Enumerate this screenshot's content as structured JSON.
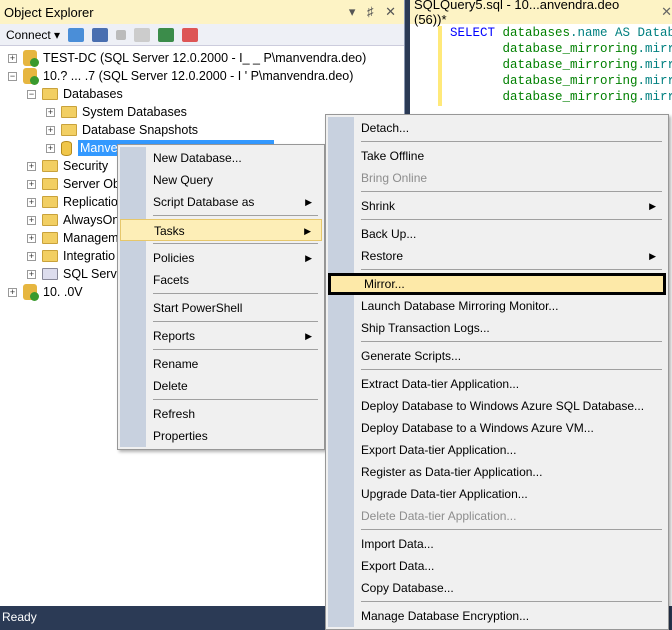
{
  "object_explorer": {
    "title": "Object Explorer",
    "controls": "▾ ♯ ✕",
    "connect_label": "Connect ▾",
    "tree": [
      {
        "label": "TEST-DC (SQL Server 12.0.2000 - I_ _ P\\manvendra.deo)",
        "level": 0,
        "exp": "+",
        "icon": "server"
      },
      {
        "label": "10.?  ...  .7 (SQL Server 12.0.2000 - I  ' P\\manvendra.deo)",
        "level": 0,
        "exp": "−",
        "icon": "server"
      },
      {
        "label": "Databases",
        "level": 1,
        "exp": "−",
        "icon": "folder"
      },
      {
        "label": "System Databases",
        "level": 2,
        "exp": "+",
        "icon": "folder"
      },
      {
        "label": "Database Snapshots",
        "level": 2,
        "exp": "+",
        "icon": "folder"
      },
      {
        "label": "Manve",
        "level": 2,
        "exp": "+",
        "icon": "db",
        "selected": true
      },
      {
        "label": "Security",
        "level": 1,
        "exp": "+",
        "icon": "folder"
      },
      {
        "label": "Server Obj",
        "level": 1,
        "exp": "+",
        "icon": "folder"
      },
      {
        "label": "Replicatio",
        "level": 1,
        "exp": "+",
        "icon": "folder"
      },
      {
        "label": "AlwaysOn",
        "level": 1,
        "exp": "+",
        "icon": "folder"
      },
      {
        "label": "Managem",
        "level": 1,
        "exp": "+",
        "icon": "folder"
      },
      {
        "label": "Integratio",
        "level": 1,
        "exp": "+",
        "icon": "folder"
      },
      {
        "label": "SQL Serve",
        "level": 1,
        "exp": "+",
        "icon": "agent"
      },
      {
        "label": "10.   .0V",
        "level": 0,
        "exp": "+",
        "icon": "server"
      }
    ]
  },
  "editor": {
    "tab_title": "SQLQuery5.sql - 10...anvendra.deo (56))*",
    "close": "✕",
    "lines": [
      [
        "SELECT ",
        "databases",
        ".name AS Databas"
      ],
      [
        "       ",
        "database_mirroring",
        ".mirror"
      ],
      [
        "       ",
        "database_mirroring",
        ".mirror"
      ],
      [
        "       ",
        "database_mirroring",
        ".mirror"
      ],
      [
        "       ",
        "database_mirroring",
        ".mirror"
      ]
    ]
  },
  "context_menu": [
    {
      "label": "New Database..."
    },
    {
      "label": "New Query"
    },
    {
      "label": "Script Database as",
      "sub": true
    },
    {
      "sep": true
    },
    {
      "label": "Tasks",
      "sub": true,
      "hl": true
    },
    {
      "sep": true
    },
    {
      "label": "Policies",
      "sub": true
    },
    {
      "label": "Facets"
    },
    {
      "sep": true
    },
    {
      "label": "Start PowerShell"
    },
    {
      "sep": true
    },
    {
      "label": "Reports",
      "sub": true
    },
    {
      "sep": true
    },
    {
      "label": "Rename"
    },
    {
      "label": "Delete"
    },
    {
      "sep": true
    },
    {
      "label": "Refresh"
    },
    {
      "label": "Properties"
    }
  ],
  "tasks_menu": [
    {
      "label": "Detach..."
    },
    {
      "sep": true
    },
    {
      "label": "Take Offline"
    },
    {
      "label": "Bring Online",
      "disabled": true
    },
    {
      "sep": true
    },
    {
      "label": "Shrink",
      "sub": true
    },
    {
      "sep": true
    },
    {
      "label": "Back Up..."
    },
    {
      "label": "Restore",
      "sub": true
    },
    {
      "sep": true
    },
    {
      "label": "Mirror...",
      "box": true
    },
    {
      "label": "Launch Database Mirroring Monitor..."
    },
    {
      "label": "Ship Transaction Logs..."
    },
    {
      "sep": true
    },
    {
      "label": "Generate Scripts..."
    },
    {
      "sep": true
    },
    {
      "label": "Extract Data-tier Application..."
    },
    {
      "label": "Deploy Database to Windows Azure SQL Database..."
    },
    {
      "label": "Deploy Database to a Windows Azure VM..."
    },
    {
      "label": "Export Data-tier Application..."
    },
    {
      "label": "Register as Data-tier Application..."
    },
    {
      "label": "Upgrade Data-tier Application..."
    },
    {
      "label": "Delete Data-tier Application...",
      "disabled": true
    },
    {
      "sep": true
    },
    {
      "label": "Import Data..."
    },
    {
      "label": "Export Data..."
    },
    {
      "label": "Copy Database..."
    },
    {
      "sep": true
    },
    {
      "label": "Manage Database Encryption..."
    }
  ],
  "status": {
    "text": "Ready"
  }
}
